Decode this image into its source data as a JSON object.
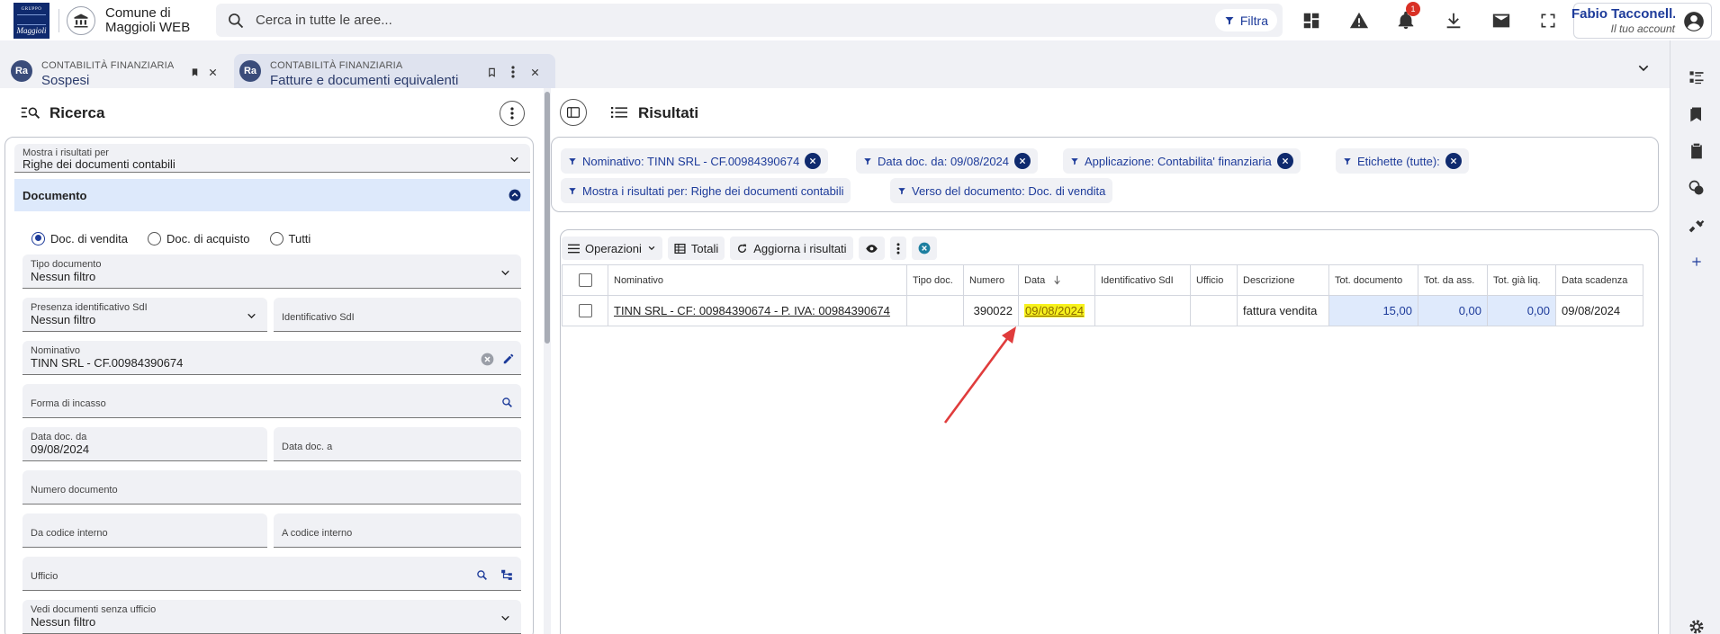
{
  "topbar": {
    "logo_top": "GRUPPO",
    "logo_bottom": "Maggioli",
    "app_name_line1": "Comune di",
    "app_name_line2": "Maggioli WEB",
    "search_placeholder": "Cerca in tutte le aree...",
    "filter_label": "Filtra",
    "notification_count": "1",
    "user_name": "Fabio Tacconell...",
    "user_sub": "Il tuo account"
  },
  "tabs": [
    {
      "icon_text": "Ra",
      "category": "CONTABILITÀ FINANZIARIA",
      "title": "Sospesi"
    },
    {
      "icon_text": "Ra",
      "category": "CONTABILITÀ FINANZIARIA",
      "title": "Fatture e documenti equivalenti"
    }
  ],
  "search_panel": {
    "title": "Ricerca",
    "show_results_label": "Mostra i risultati per",
    "show_results_value": "Righe dei documenti contabili",
    "section_title": "Documento",
    "radio_options": [
      "Doc. di vendita",
      "Doc. di acquisto",
      "Tutti"
    ],
    "radio_selected": "Doc. di vendita",
    "fields": {
      "tipo_documento_label": "Tipo documento",
      "tipo_documento_value": "Nessun filtro",
      "presenza_sdi_label": "Presenza identificativo SdI",
      "presenza_sdi_value": "Nessun filtro",
      "identificativo_sdi_label": "Identificativo SdI",
      "nominativo_label": "Nominativo",
      "nominativo_value": "TINN SRL - CF.00984390674",
      "forma_incasso_label": "Forma di incasso",
      "data_da_label": "Data doc. da",
      "data_da_value": "09/08/2024",
      "data_a_label": "Data doc. a",
      "numero_documento_label": "Numero documento",
      "da_codice_label": "Da codice interno",
      "a_codice_label": "A codice interno",
      "ufficio_label": "Ufficio",
      "vedi_senza_ufficio_label": "Vedi documenti senza ufficio",
      "vedi_senza_ufficio_value": "Nessun filtro"
    }
  },
  "results_panel": {
    "title": "Risultati",
    "chips": [
      "Nominativo: TINN SRL - CF.00984390674",
      "Data doc. da: 09/08/2024",
      "Applicazione: Contabilita' finanziaria",
      "Etichette (tutte):",
      "Mostra i risultati per: Righe dei documenti contabili",
      "Verso del documento: Doc. di vendita"
    ],
    "toolbar": {
      "operazioni": "Operazioni",
      "totali": "Totali",
      "aggiorna": "Aggiorna i risultati"
    },
    "columns": [
      "Nominativo",
      "Tipo doc.",
      "Numero",
      "Data",
      "Identificativo SdI",
      "Ufficio",
      "Descrizione",
      "Tot. documento",
      "Tot. da ass.",
      "Tot. già liq.",
      "Data scadenza"
    ],
    "rows": [
      {
        "nominativo": "TINN SRL - CF: 00984390674 - P. IVA: 00984390674",
        "tipo_doc": "",
        "numero": "390022",
        "data": "09/08/2024",
        "identificativo_sdi": "",
        "ufficio": "",
        "descrizione": "fattura vendita",
        "tot_documento": "15,00",
        "tot_da_ass": "0,00",
        "tot_gia_liq": "0,00",
        "data_scadenza": "09/08/2024"
      }
    ]
  },
  "colors": {
    "brand_blue": "#1d3b9a",
    "navy": "#0f2a6e",
    "highlight": "#f7f21d",
    "arrow": "#e03c3c",
    "section_bg": "#dde9fb"
  }
}
